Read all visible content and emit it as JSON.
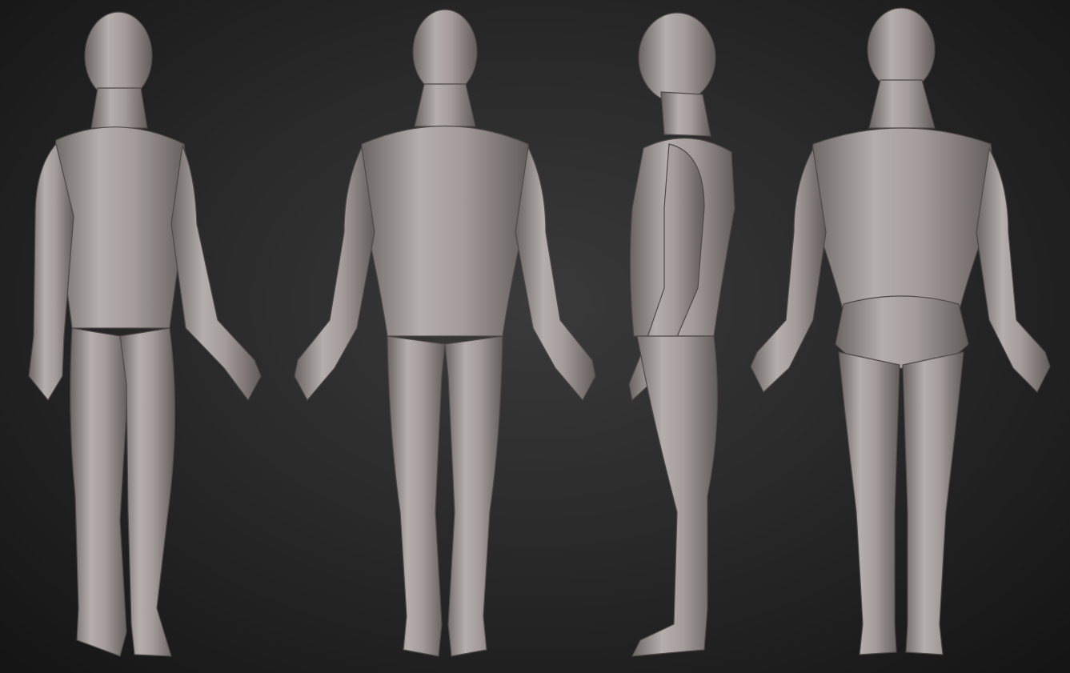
{
  "scene": {
    "subject": "",
    "views": [
      {
        "view": "three-quarter"
      },
      {
        "view": "front"
      },
      {
        "view": "side"
      },
      {
        "view": "back"
      }
    ],
    "colors": {
      "background_center": "#3a3a3a",
      "background_edge": "#141414",
      "clay_light": "#b9b3b1",
      "clay_mid": "#8f8886",
      "clay_dark": "#5d5756"
    }
  }
}
